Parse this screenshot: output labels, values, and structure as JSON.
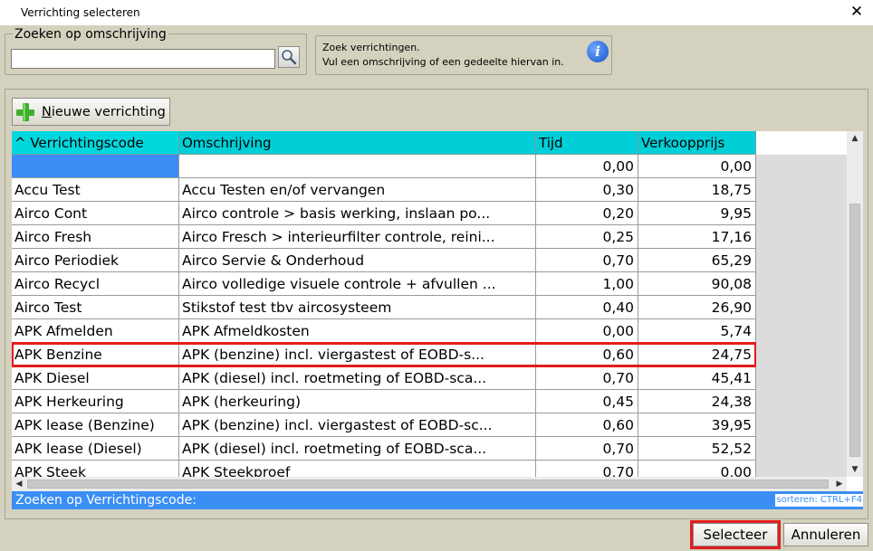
{
  "window": {
    "title": "Verrichting selecteren",
    "close_glyph": "✕"
  },
  "search": {
    "legend": "Zoeken op omschrijving",
    "value": "",
    "placeholder": "",
    "button_icon": "magnifier-icon"
  },
  "info": {
    "line1": "Zoek verrichtingen.",
    "line2": "Vul een omschrijving of een gedeelte hiervan in.",
    "icon": "info-icon"
  },
  "toolbar": {
    "new_label_accel": "N",
    "new_label_rest": "ieuwe verrichting",
    "new_icon": "plus-icon"
  },
  "grid": {
    "columns": [
      "^ Verrichtingscode",
      "Omschrijving",
      "Tijd",
      "Verkoopprijs"
    ],
    "rows": [
      {
        "code": "",
        "desc": "",
        "tijd": "0,00",
        "prijs": "0,00",
        "selected": true
      },
      {
        "code": "Accu Test",
        "desc": "Accu Testen en/of vervangen",
        "tijd": "0,30",
        "prijs": "18,75"
      },
      {
        "code": "Airco Cont",
        "desc": "Airco controle > basis werking, inslaan po...",
        "tijd": "0,20",
        "prijs": "9,95"
      },
      {
        "code": "Airco Fresh",
        "desc": "Airco Fresch > interieurfilter controle, reini...",
        "tijd": "0,25",
        "prijs": "17,16"
      },
      {
        "code": "Airco Periodiek",
        "desc": "Airco Servie & Onderhoud",
        "tijd": "0,70",
        "prijs": "65,29"
      },
      {
        "code": "Airco Recycl",
        "desc": "Airco volledige visuele controle + afvullen ...",
        "tijd": "1,00",
        "prijs": "90,08"
      },
      {
        "code": "Airco Test",
        "desc": "Stikstof test tbv aircosysteem",
        "tijd": "0,40",
        "prijs": "26,90"
      },
      {
        "code": "APK Afmelden",
        "desc": "APK Afmeldkosten",
        "tijd": "0,00",
        "prijs": "5,74"
      },
      {
        "code": "APK Benzine",
        "desc": "APK (benzine) incl. viergastest of  EOBD-s...",
        "tijd": "0,60",
        "prijs": "24,75",
        "highlighted": true
      },
      {
        "code": "APK Diesel",
        "desc": "APK (diesel) incl. roetmeting of  EOBD-sca...",
        "tijd": "0,70",
        "prijs": "45,41"
      },
      {
        "code": "APK Herkeuring",
        "desc": "APK (herkeuring)",
        "tijd": "0,45",
        "prijs": "24,38"
      },
      {
        "code": "APK lease (Benzine)",
        "desc": "APK (benzine) incl. viergastest of EOBD-sc...",
        "tijd": "0,60",
        "prijs": "39,95"
      },
      {
        "code": "APK lease (Diesel)",
        "desc": "APK (diesel) incl. roetmeting of  EOBD-sca...",
        "tijd": "0,70",
        "prijs": "52,52"
      },
      {
        "code": "APK Steek",
        "desc": "APK Steekproef",
        "tijd": "0,70",
        "prijs": "0,00"
      }
    ]
  },
  "status": {
    "label": "Zoeken op Verrichtingscode:",
    "sort_hint": "sorteren: CTRL+F4"
  },
  "footer": {
    "select_label": "Selecteer",
    "cancel_label": "Annuleren"
  },
  "colors": {
    "header_bg": "#00cfd8",
    "selection": "#3a8ef6",
    "highlight_outline": "#e31c1c",
    "dialog_bg": "#d4d1be"
  }
}
